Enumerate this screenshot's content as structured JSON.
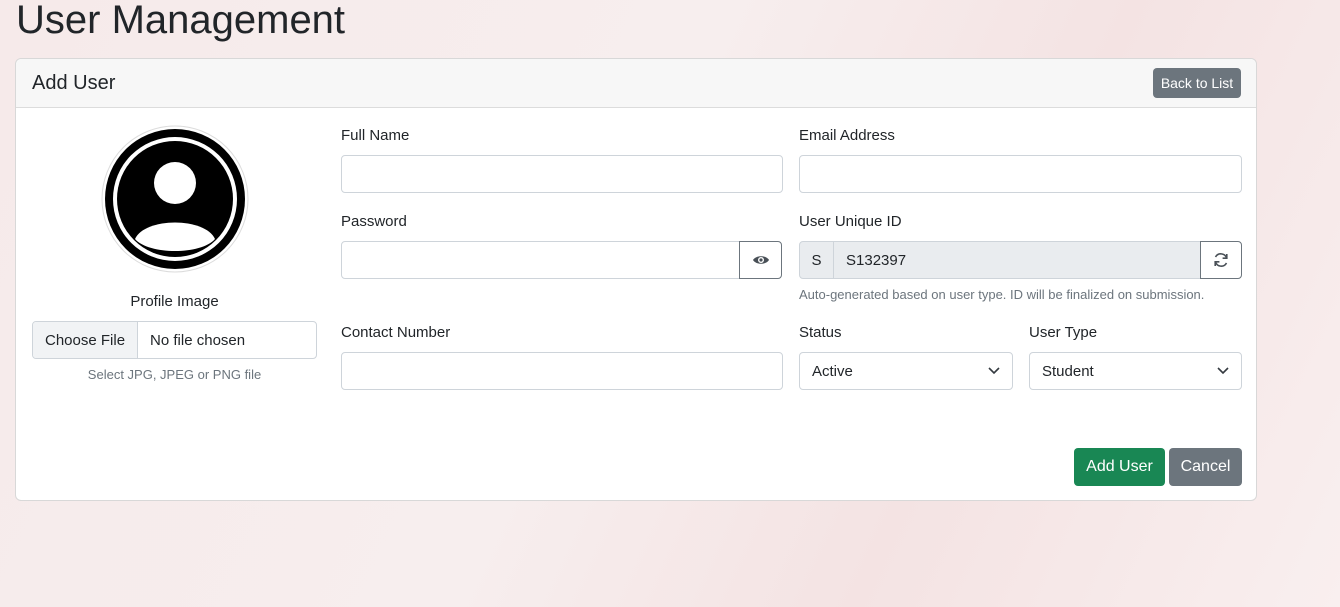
{
  "page": {
    "title": "User Management"
  },
  "card": {
    "title": "Add User",
    "back_label": "Back to List"
  },
  "profile": {
    "label": "Profile Image",
    "file_button": "Choose File",
    "file_status": "No file chosen",
    "hint": "Select JPG, JPEG or PNG file"
  },
  "form": {
    "full_name": {
      "label": "Full Name",
      "value": ""
    },
    "email": {
      "label": "Email Address",
      "value": ""
    },
    "password": {
      "label": "Password",
      "value": ""
    },
    "unique_id": {
      "label": "User Unique ID",
      "prefix": "S",
      "value": "S132397",
      "help": "Auto-generated based on user type. ID will be finalized on submission."
    },
    "contact": {
      "label": "Contact Number",
      "value": ""
    },
    "status": {
      "label": "Status",
      "value": "Active"
    },
    "user_type": {
      "label": "User Type",
      "value": "Student"
    }
  },
  "actions": {
    "add_label": "Add User",
    "cancel_label": "Cancel"
  },
  "colors": {
    "success": "#198754",
    "secondary": "#6c757d"
  },
  "icons": [
    "user-avatar-icon",
    "eye-icon",
    "refresh-icon",
    "chevron-down-icon"
  ]
}
